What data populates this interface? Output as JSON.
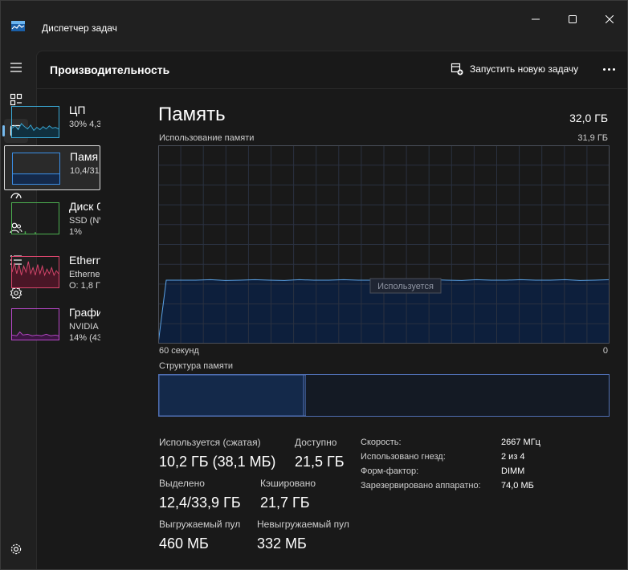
{
  "window": {
    "title": "Диспетчер задач",
    "controls": [
      "minimize-icon",
      "maximize-icon",
      "close-icon"
    ]
  },
  "nav": {
    "items": [
      {
        "icon": "hamburger-menu-icon",
        "active": false
      },
      {
        "icon": "processes-icon",
        "active": false
      },
      {
        "icon": "performance-icon",
        "active": true
      },
      {
        "icon": "app-history-icon",
        "active": false
      },
      {
        "icon": "startup-apps-icon",
        "active": false
      },
      {
        "icon": "users-icon",
        "active": false
      },
      {
        "icon": "details-icon",
        "active": false
      },
      {
        "icon": "services-icon",
        "active": false
      },
      {
        "icon": "settings-icon",
        "active": false
      }
    ]
  },
  "header": {
    "title": "Производительность",
    "run_task_label": "Запустить новую задачу",
    "more_icon": "more-icon"
  },
  "devices": [
    {
      "name": "ЦП",
      "sub1": "30% 4,3",
      "sub2": "",
      "color": "#3aa9d6"
    },
    {
      "name": "Памя",
      "sub1": "10,4/31,",
      "sub2": "",
      "color": "#3a8ee6"
    },
    {
      "name": "Диск 0",
      "sub1": "SSD (NV",
      "sub2": "1%",
      "color": "#4caf50"
    },
    {
      "name": "Ethern",
      "sub1": "Etherne",
      "sub2": "О: 1,8 Г",
      "color": "#d6456b"
    },
    {
      "name": "Графи",
      "sub1": "NVIDIA",
      "sub2": "14% (43",
      "color": "#b748c8"
    }
  ],
  "memory": {
    "title": "Память",
    "total": "32,0 ГБ",
    "usage_label": "Использование памяти",
    "usage_max": "31,9 ГБ",
    "in_use_tooltip": "Используется",
    "axis_left": "60 секунд",
    "axis_right": "0",
    "structure_label": "Структура памяти",
    "usage_fraction": 0.32,
    "colors": {
      "line": "#5aa3e8",
      "fill": "#0d1f3c",
      "grid": "#2a3140",
      "border": "#4a4f5a"
    },
    "stats": {
      "in_use_label": "Используется (сжатая)",
      "in_use_value": "10,2 ГБ (38,1 МБ)",
      "available_label": "Доступно",
      "available_value": "21,5 ГБ",
      "committed_label": "Выделено",
      "committed_value": "12,4/33,9 ГБ",
      "cached_label": "Кэшировано",
      "cached_value": "21,7 ГБ",
      "paged_label": "Выгружаемый пул",
      "paged_value": "460 МБ",
      "nonpaged_label": "Невыгружаемый пул",
      "nonpaged_value": "332 МБ"
    },
    "specs": [
      {
        "label": "Скорость:",
        "value": "2667 МГц"
      },
      {
        "label": "Использовано гнезд:",
        "value": "2 из 4"
      },
      {
        "label": "Форм-фактор:",
        "value": "DIMM"
      },
      {
        "label": "Зарезервировано аппаратно:",
        "value": "74,0 МБ"
      }
    ]
  }
}
